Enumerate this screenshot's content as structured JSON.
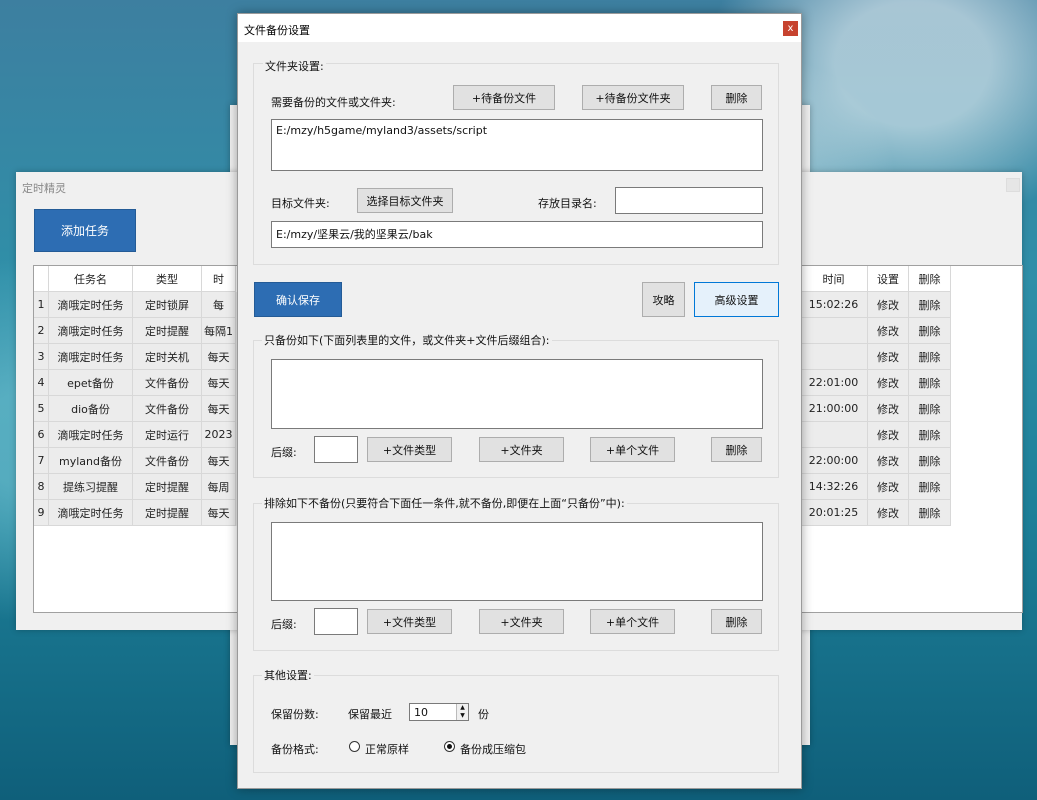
{
  "main_window": {
    "title": "定时精灵",
    "add_task_label": "添加任务",
    "columns": [
      "",
      "任务名",
      "类型",
      "时",
      "时间",
      "设置",
      "删除"
    ],
    "rows": [
      {
        "num": "1",
        "name": "滴哦定时任务",
        "type": "定时锁屏",
        "when": "每",
        "time": "15:02:26",
        "edit": "修改",
        "del": "删除"
      },
      {
        "num": "2",
        "name": "滴哦定时任务",
        "type": "定时提醒",
        "when": "每隔1",
        "time": "",
        "edit": "修改",
        "del": "删除"
      },
      {
        "num": "3",
        "name": "滴哦定时任务",
        "type": "定时关机",
        "when": "每天",
        "time": "",
        "edit": "修改",
        "del": "删除"
      },
      {
        "num": "4",
        "name": "epet备份",
        "type": "文件备份",
        "when": "每天",
        "time": "22:01:00",
        "edit": "修改",
        "del": "删除"
      },
      {
        "num": "5",
        "name": "dio备份",
        "type": "文件备份",
        "when": "每天",
        "time": "21:00:00",
        "edit": "修改",
        "del": "删除"
      },
      {
        "num": "6",
        "name": "滴哦定时任务",
        "type": "定时运行",
        "when": "2023",
        "time": "",
        "edit": "修改",
        "del": "删除"
      },
      {
        "num": "7",
        "name": "myland备份",
        "type": "文件备份",
        "when": "每天",
        "time": "22:00:00",
        "edit": "修改",
        "del": "删除"
      },
      {
        "num": "8",
        "name": "提练习提醒",
        "type": "定时提醒",
        "when": "每周",
        "time": "14:32:26",
        "edit": "修改",
        "del": "删除"
      },
      {
        "num": "9",
        "name": "滴哦定时任务",
        "type": "定时提醒",
        "when": "每天",
        "time": "20:01:25",
        "edit": "修改",
        "del": "删除"
      }
    ]
  },
  "dialog": {
    "title": "文件备份设置",
    "close_label": "x",
    "folder_section": {
      "label": "文件夹设置:",
      "source_label": "需要备份的文件或文件夹:",
      "add_file_btn": "+待备份文件",
      "add_folder_btn": "+待备份文件夹",
      "delete_btn": "删除",
      "source_value": "E:/mzy/h5game/myland3/assets/script",
      "target_label": "目标文件夹:",
      "choose_target_btn": "选择目标文件夹",
      "store_dir_label": "存放目录名:",
      "store_dir_value": "",
      "target_value": "E:/mzy/坚果云/我的坚果云/bak"
    },
    "confirm_btn": "确认保存",
    "guide_btn": "攻略",
    "advanced_btn": "高级设置",
    "include_section": {
      "label": "只备份如下(下面列表里的文件，或文件夹+文件后缀组合):",
      "list_value": "",
      "suffix_label": "后缀:",
      "suffix_value": "",
      "add_type_btn": "+文件类型",
      "add_folder_btn": "+文件夹",
      "add_single_btn": "+单个文件",
      "delete_btn": "删除"
    },
    "exclude_section": {
      "label": "排除如下不备份(只要符合下面任一条件,就不备份,即便在上面“只备份”中):",
      "list_value": "",
      "suffix_label": "后缀:",
      "suffix_value": "",
      "add_type_btn": "+文件类型",
      "add_folder_btn": "+文件夹",
      "add_single_btn": "+单个文件",
      "delete_btn": "删除"
    },
    "other_section": {
      "label": "其他设置:",
      "keep_label": "保留份数:",
      "keep_recent_label": "保留最近",
      "keep_value": "10",
      "keep_unit": "份",
      "format_label": "备份格式:",
      "format_options": [
        "正常原样",
        "备份成压缩包"
      ],
      "format_selected": "备份成压缩包"
    }
  }
}
